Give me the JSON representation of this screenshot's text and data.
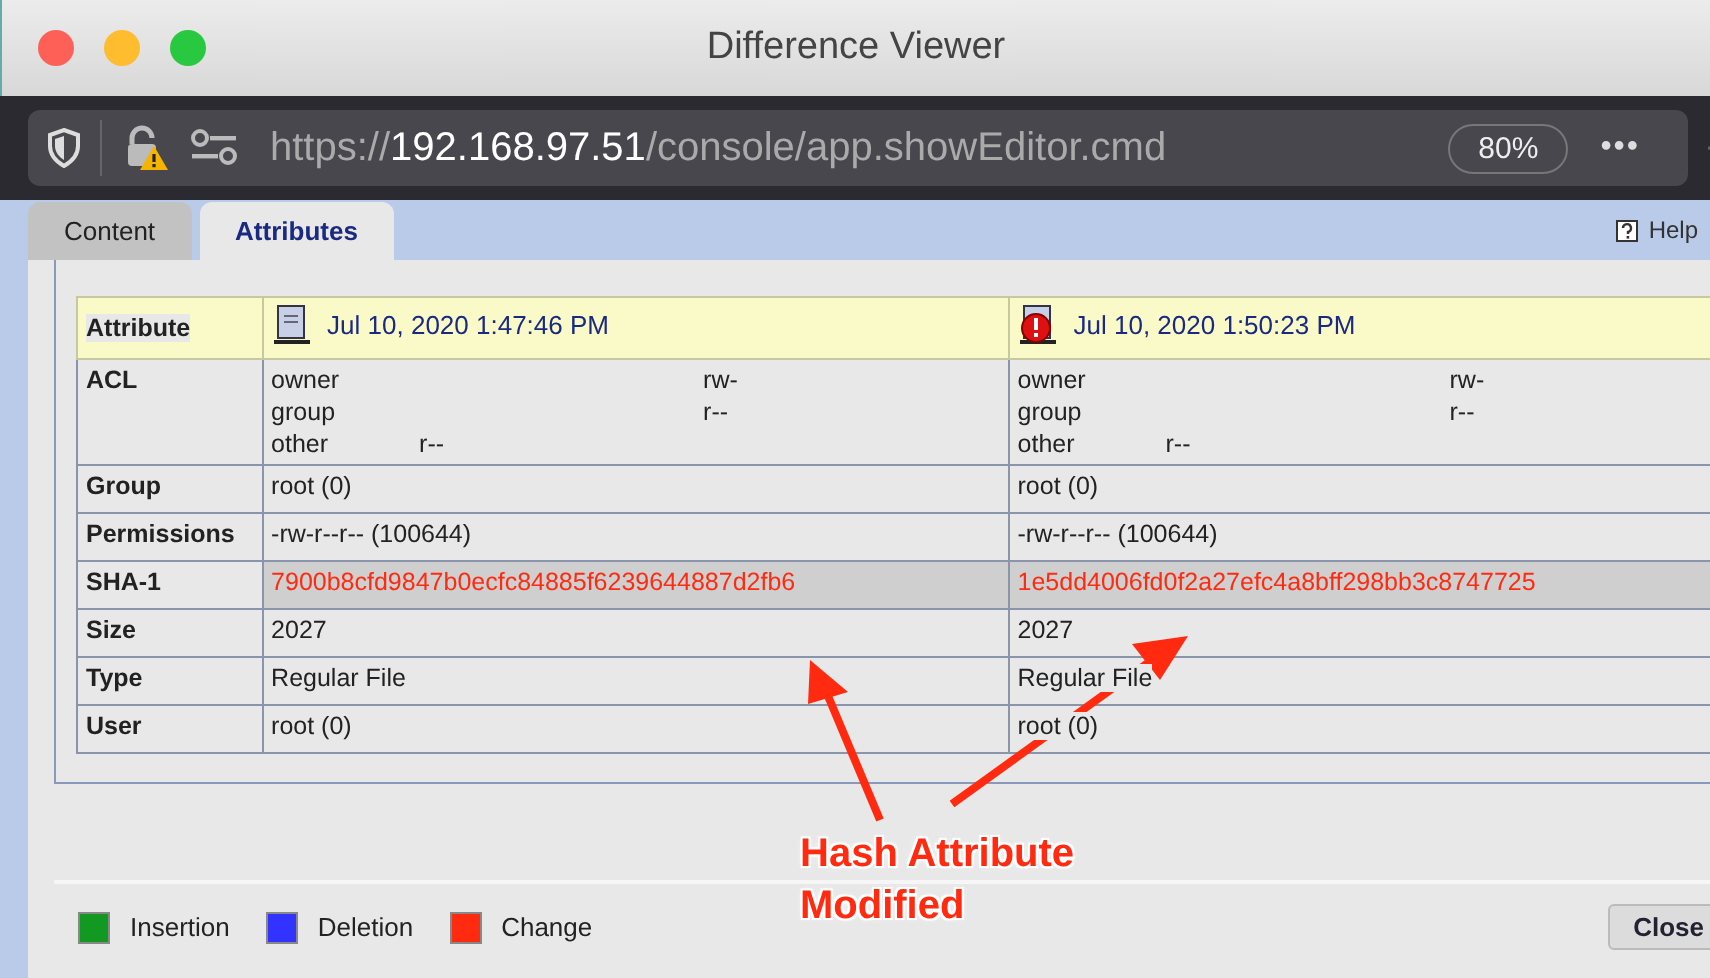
{
  "window": {
    "title": "Difference Viewer"
  },
  "browser": {
    "url": {
      "scheme": "https://",
      "host": "192.168.97.51",
      "path": "/console/app.showEditor.cmd"
    },
    "zoom": "80%",
    "more": "•••"
  },
  "tabs": [
    {
      "label": "Content",
      "selected": false
    },
    {
      "label": "Attributes",
      "selected": true
    }
  ],
  "help": "Help",
  "table": {
    "header": {
      "label": "Attribute",
      "versions": [
        {
          "date": "Jul 10, 2020 1:47:46 PM",
          "kind": "plain"
        },
        {
          "date": "Jul 10, 2020 1:50:23 PM",
          "kind": "error"
        }
      ]
    },
    "rows": [
      {
        "label": "ACL",
        "kind": "acl",
        "changed": false,
        "values": [
          [
            {
              "name": "owner",
              "perm": "rw-",
              "kind": "wide"
            },
            {
              "name": "group",
              "perm": "r--",
              "kind": "wide"
            },
            {
              "name": "other",
              "perm": "r--",
              "kind": "narrow"
            }
          ],
          [
            {
              "name": "owner",
              "perm": "rw-",
              "kind": "wide"
            },
            {
              "name": "group",
              "perm": "r--",
              "kind": "wide"
            },
            {
              "name": "other",
              "perm": "r--",
              "kind": "narrow"
            }
          ]
        ]
      },
      {
        "label": "Group",
        "kind": "text",
        "changed": false,
        "values": [
          "root (0)",
          "root (0)"
        ]
      },
      {
        "label": "Permissions",
        "kind": "text",
        "changed": false,
        "values": [
          "-rw-r--r-- (100644)",
          "-rw-r--r-- (100644)"
        ]
      },
      {
        "label": "SHA-1",
        "kind": "text",
        "changed": true,
        "values": [
          "7900b8cfd9847b0ecfc84885f6239644887d2fb6",
          "1e5dd4006fd0f2a27efc4a8bff298bb3c8747725"
        ]
      },
      {
        "label": "Size",
        "kind": "text",
        "changed": false,
        "values": [
          "2027",
          "2027"
        ]
      },
      {
        "label": "Type",
        "kind": "text",
        "changed": false,
        "values": [
          "Regular File",
          "Regular File"
        ]
      },
      {
        "label": "User",
        "kind": "text",
        "changed": false,
        "values": [
          "root (0)",
          "root (0)"
        ]
      }
    ]
  },
  "legend": [
    {
      "label": "Insertion",
      "color": "#119922"
    },
    {
      "label": "Deletion",
      "color": "#3333ff"
    },
    {
      "label": "Change",
      "color": "#ff2a10"
    }
  ],
  "close": "Close",
  "annotation": {
    "lines": [
      "Hash Attribute",
      "Modified"
    ]
  }
}
